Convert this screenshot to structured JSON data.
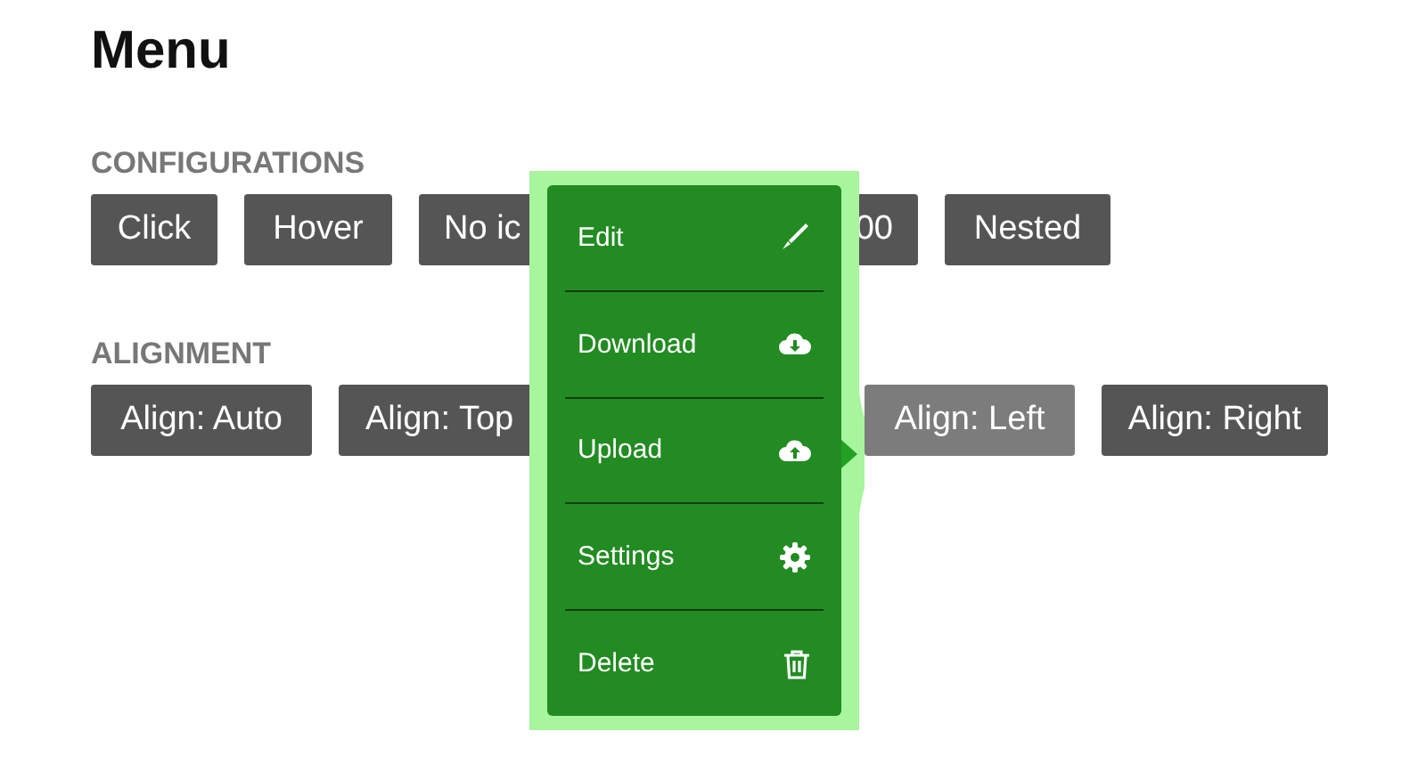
{
  "title": "Menu",
  "sections": [
    {
      "heading": "CONFIGURATIONS",
      "buttons": [
        {
          "label": "Click",
          "selected": false
        },
        {
          "label": "Hover",
          "selected": false
        },
        {
          "label": "No ic",
          "selected": false
        },
        {
          "label": "00",
          "selected": false
        },
        {
          "label": "Nested",
          "selected": false
        }
      ]
    },
    {
      "heading": "ALIGNMENT",
      "buttons": [
        {
          "label": "Align: Auto",
          "selected": false
        },
        {
          "label": "Align: Top",
          "selected": false
        },
        {
          "label": "Align: Left",
          "selected": true
        },
        {
          "label": "Align: Right",
          "selected": false
        }
      ]
    }
  ],
  "menu": {
    "items": [
      {
        "label": "Edit"
      },
      {
        "label": "Download"
      },
      {
        "label": "Upload"
      },
      {
        "label": "Settings"
      },
      {
        "label": "Delete"
      }
    ]
  }
}
